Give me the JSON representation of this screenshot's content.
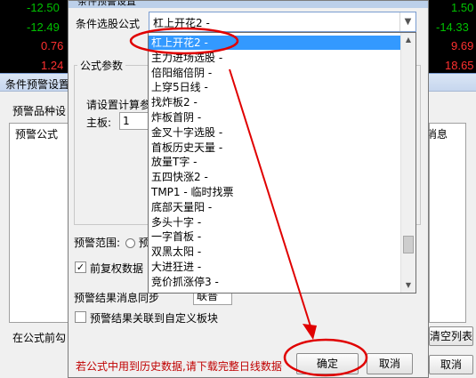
{
  "ticker": {
    "left": [
      {
        "text": "-12.50",
        "color": "green"
      },
      {
        "text": "-12.49",
        "color": "green"
      },
      {
        "text": "0.76",
        "color": "red"
      },
      {
        "text": "1.24",
        "color": "red"
      }
    ],
    "right": [
      {
        "text": "1.50",
        "color": "green"
      },
      {
        "text": "-14.33",
        "color": "green"
      },
      {
        "text": "9.69",
        "color": "red"
      },
      {
        "text": "18.65",
        "color": "red"
      }
    ]
  },
  "background_window": {
    "title": "条件预警设置",
    "variety_label": "预警品种设",
    "formula_col": "预警公式",
    "msg_col": "消息",
    "before_formula": "在公式前勾",
    "clear_button": "清空列表",
    "cancel_button": "取消"
  },
  "dialog": {
    "title": "条件预警设置",
    "formula_label": "条件选股公式",
    "formula_value": "杠上开花2  -",
    "params_group": "公式参数",
    "calc_label": "请设置计算参",
    "main_board_label": "主板:",
    "main_board_value": "1",
    "range_label": "预警范围:",
    "range_value": "预",
    "adjust_checkbox": "前复权数据",
    "adjust_checked": true,
    "sync_label": "预警结果消息同步",
    "sync_value": "联普",
    "link_checkbox": "预警结果关联到自定义板块",
    "link_checked": false,
    "warning_text": "若公式中用到历史数据,请下载完整日线数据",
    "ok_button": "确定",
    "cancel_button": "取消"
  },
  "dropdown": {
    "items": [
      "杠上开花2  -",
      "主力进场选股  -",
      "倍阳缩倍阴  -",
      "上穿5日线  -",
      "找炸板2  -",
      "炸板首阴  -",
      "金叉十字选股  -",
      "首板历史天量  -",
      "放量T字  -",
      "五四快涨2  -",
      "TMP1  -  临时找票",
      "底部天量阳  -",
      "多头十字  -",
      "一字首板  -",
      "双黑太阳  -",
      "大进狂进  -",
      "竞价抓涨停3  -"
    ],
    "selected_index": 0
  },
  "annotation_color": "#e00000"
}
